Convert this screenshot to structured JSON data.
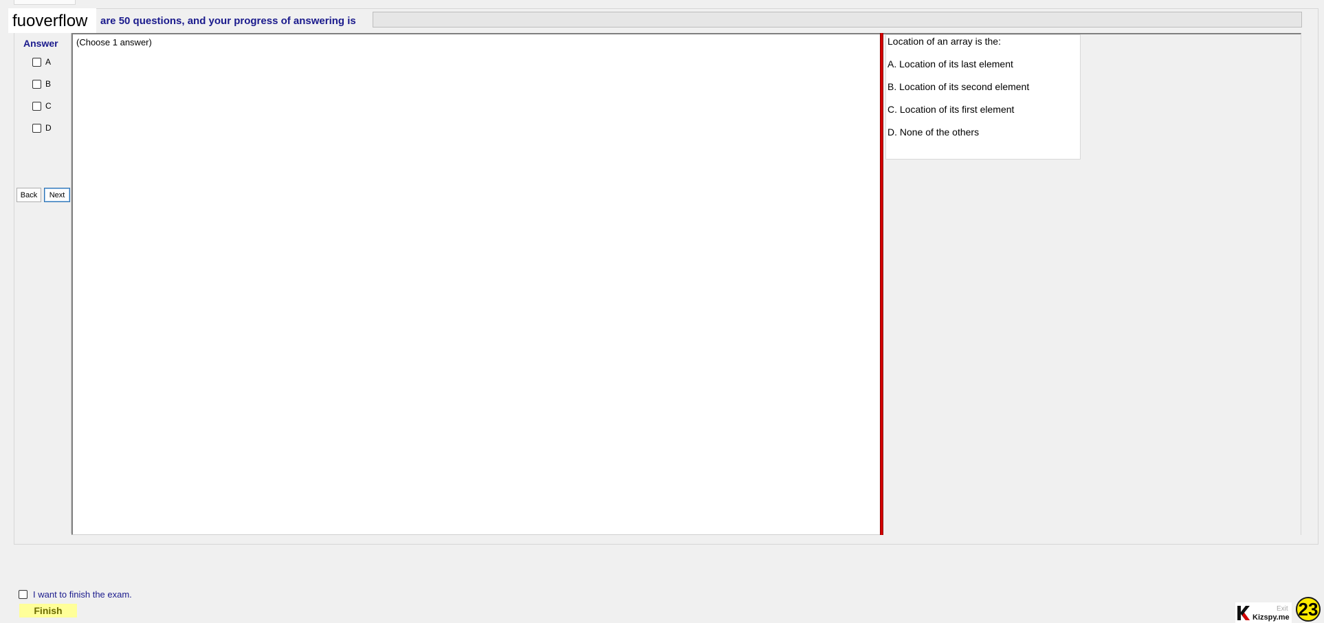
{
  "watermark": "fuoverflow",
  "header": {
    "progress_text": "are 50 questions, and your progress of answering is",
    "progress_value": 0
  },
  "answer_panel": {
    "title": "Answer",
    "options": [
      {
        "letter": "A",
        "checked": false
      },
      {
        "letter": "B",
        "checked": false
      },
      {
        "letter": "C",
        "checked": false
      },
      {
        "letter": "D",
        "checked": false
      }
    ],
    "back_label": "Back",
    "next_label": "Next"
  },
  "center": {
    "instruction": "(Choose 1 answer)"
  },
  "question": {
    "stem": "Location of an array is the:",
    "options": [
      "A.  Location of its last element",
      "B.  Location of its second element",
      "C.  Location of its first element",
      "D.  None of the others"
    ]
  },
  "finish": {
    "checkbox_label": "I want to finish the exam.",
    "checked": false,
    "button_label": "Finish"
  },
  "branding": {
    "site": "Kizspy.me",
    "exit_label": "Exit",
    "badge": "23",
    "badge_color": "#ffeb00"
  },
  "colors": {
    "accent_text": "#1a1a8c",
    "splitter": "#d40000",
    "finish_button": "#ffff99"
  }
}
